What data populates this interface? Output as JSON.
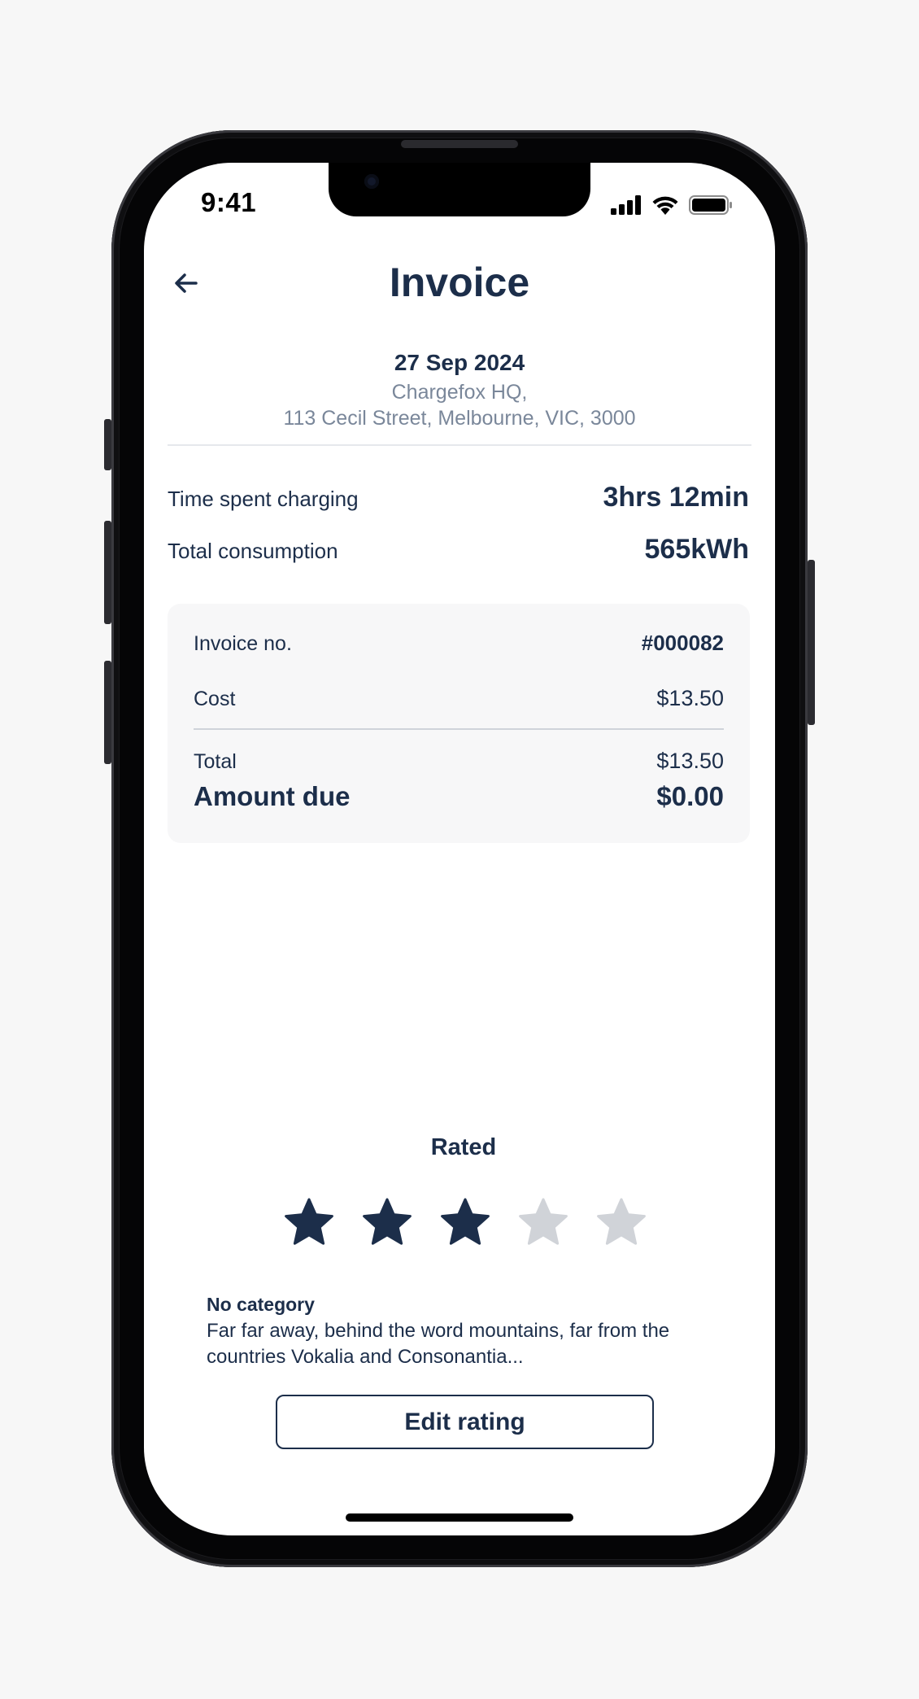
{
  "status_bar": {
    "time": "9:41",
    "icons": [
      "cellular-signal-icon",
      "wifi-icon",
      "battery-icon"
    ]
  },
  "header": {
    "title": "Invoice",
    "back_icon": "arrow-left-icon"
  },
  "session": {
    "date": "27 Sep 2024",
    "location_line1": "Chargefox HQ,",
    "location_line2": "113 Cecil Street, Melbourne, VIC, 3000"
  },
  "stats": {
    "time_label": "Time spent charging",
    "time_value": "3hrs 12min",
    "consumption_label": "Total consumption",
    "consumption_value": "565kWh"
  },
  "invoice": {
    "number_label": "Invoice no.",
    "number_value": "#000082",
    "cost_label": "Cost",
    "cost_value": "$13.50",
    "total_label": "Total",
    "total_value": "$13.50",
    "amount_due_label": "Amount due",
    "amount_due_value": "$0.00"
  },
  "rating": {
    "heading": "Rated",
    "stars_filled": 3,
    "stars_total": 5,
    "category": "No category",
    "comment": "Far far away, behind the word mountains, far from the countries Vokalia and Consonantia...",
    "edit_label": "Edit rating"
  },
  "colors": {
    "primary": "#1c2e4a",
    "muted": "#7a879a",
    "star_empty": "#d0d3d8",
    "card_bg": "#f7f7f8"
  }
}
